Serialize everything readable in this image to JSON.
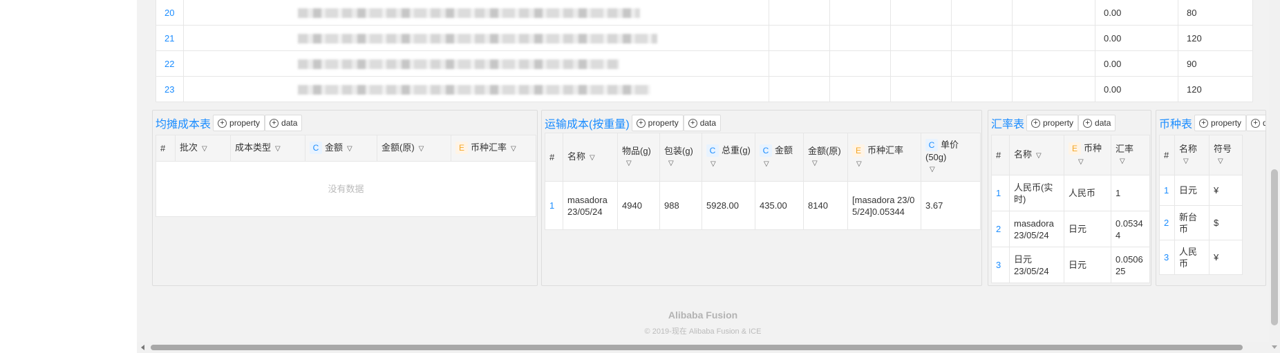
{
  "top_table": {
    "rows": [
      {
        "index": "20",
        "amount": "0.00",
        "qty": "80"
      },
      {
        "index": "21",
        "amount": "0.00",
        "qty": "120"
      },
      {
        "index": "22",
        "amount": "0.00",
        "qty": "90"
      },
      {
        "index": "23",
        "amount": "0.00",
        "qty": "120"
      }
    ]
  },
  "toolbar": {
    "property_label": "property",
    "data_label": "data",
    "plus_icon": "plus-circle-icon"
  },
  "panel_allocation": {
    "title": "均摊成本表",
    "columns": [
      "#",
      "批次",
      "成本类型",
      "金额",
      "金额(原)",
      "币种汇率"
    ],
    "badges": {
      "amount": "C",
      "currency_rate": "E"
    },
    "empty_text": "没有数据"
  },
  "panel_shipping": {
    "title": "运输成本(按重量)",
    "columns": [
      "#",
      "名称",
      "物品(g)",
      "包装(g)",
      "总重(g)",
      "金额",
      "金额(原)",
      "币种汇率",
      "单价(50g)"
    ],
    "badges": {
      "total_weight": "C",
      "amount": "C",
      "currency_rate": "E",
      "unit_price": "C"
    },
    "rows": [
      {
        "index": "1",
        "name": "masadora 23/05/24",
        "item_g": "4940",
        "pack_g": "988",
        "total_g": "5928.00",
        "amount": "435.00",
        "amount_orig": "8140",
        "currency_rate": "[masadora 23/05/24]0.05344",
        "unit_price": "3.67"
      }
    ]
  },
  "panel_rates": {
    "title": "汇率表",
    "columns": [
      "#",
      "名称",
      "币种",
      "汇率"
    ],
    "badges": {
      "currency": "E"
    },
    "rows": [
      {
        "index": "1",
        "name": "人民币(实时)",
        "currency": "人民币",
        "rate": "1"
      },
      {
        "index": "2",
        "name": "masadora 23/05/24",
        "currency": "日元",
        "rate": "0.05344"
      },
      {
        "index": "3",
        "name": "日元 23/05/24",
        "currency": "日元",
        "rate": "0.050625"
      }
    ]
  },
  "panel_currency": {
    "title": "币种表",
    "columns": [
      "#",
      "名称",
      "符号"
    ],
    "data_label_cut": "da",
    "rows": [
      {
        "index": "1",
        "name": "日元",
        "symbol": "¥"
      },
      {
        "index": "2",
        "name": "新台币",
        "symbol": "$"
      },
      {
        "index": "3",
        "name": "人民币",
        "symbol": "¥"
      }
    ]
  },
  "footer": {
    "brand": "Alibaba Fusion",
    "copyright": "© 2019-现在 Alibaba Fusion & ICE"
  },
  "colors": {
    "link": "#1a8cff",
    "badge_c": "#1a8cff",
    "badge_e": "#f5a623",
    "background": "#f2f2f2"
  }
}
